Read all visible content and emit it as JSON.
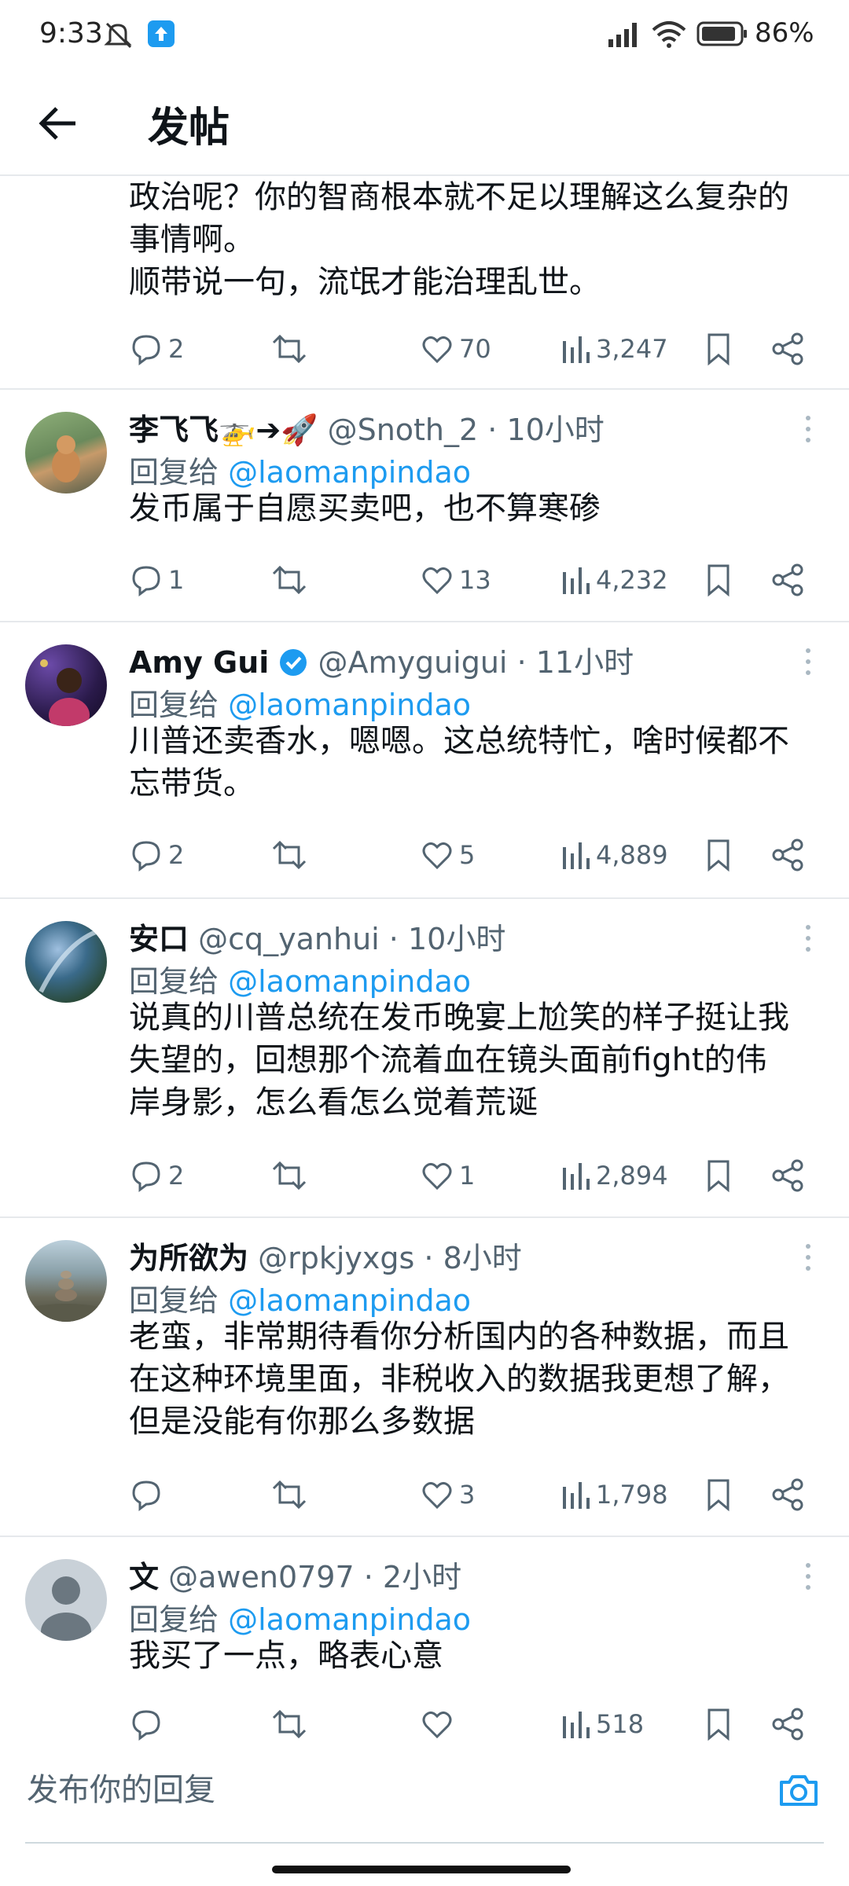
{
  "status_bar": {
    "time": "9:33",
    "battery": "86%"
  },
  "header": {
    "title": "发帖"
  },
  "partial_tweet": {
    "text_lines": [
      "政治呢？你的智商根本就不足以理解这么复杂的",
      "事情啊。",
      "顺带说一句，流氓才能治理乱世。"
    ],
    "stats": {
      "replies": "2",
      "retweets": "",
      "likes": "70",
      "views": "3,247"
    }
  },
  "reply_prefix": "回复给",
  "tweets": [
    {
      "name": "李飞飞🚁➔🚀",
      "handle": "@Snoth_2",
      "time": "10小时",
      "reply_to": "@laomanpindao",
      "text_lines": [
        "发币属于自愿买卖吧，也不算寒碜"
      ],
      "stats": {
        "replies": "1",
        "retweets": "",
        "likes": "13",
        "views": "4,232"
      }
    },
    {
      "name": "Amy Gui",
      "verified": true,
      "handle": "@Amyguigui",
      "time": "11小时",
      "reply_to": "@laomanpindao",
      "text_lines": [
        "川普还卖香水，嗯嗯。这总统特忙，啥时候都不",
        "忘带货。"
      ],
      "stats": {
        "replies": "2",
        "retweets": "",
        "likes": "5",
        "views": "4,889"
      }
    },
    {
      "name": "安口",
      "handle": "@cq_yanhui",
      "time": "10小时",
      "reply_to": "@laomanpindao",
      "text_lines": [
        "说真的川普总统在发币晚宴上尬笑的样子挺让我",
        "失望的，回想那个流着血在镜头面前fight的伟",
        "岸身影，怎么看怎么觉着荒诞"
      ],
      "stats": {
        "replies": "2",
        "retweets": "",
        "likes": "1",
        "views": "2,894"
      }
    },
    {
      "name": "为所欲为",
      "handle": "@rpkjyxgs",
      "time": "8小时",
      "reply_to": "@laomanpindao",
      "text_lines": [
        "老蛮，非常期待看你分析国内的各种数据，而且",
        "在这种环境里面，非税收入的数据我更想了解，",
        "但是没能有你那么多数据"
      ],
      "stats": {
        "replies": "",
        "retweets": "",
        "likes": "3",
        "views": "1,798"
      }
    },
    {
      "name": "文",
      "handle": "@awen0797",
      "time": "2小时",
      "reply_to": "@laomanpindao",
      "text_lines": [
        "我买了一点，略表心意"
      ],
      "stats": {
        "replies": "",
        "retweets": "",
        "likes": "",
        "views": "518"
      }
    }
  ],
  "compose": {
    "placeholder": "发布你的回复"
  },
  "colors": {
    "accent": "#1d9bf0",
    "text": "#0f1419",
    "secondary": "#536471",
    "divider": "#e6e9ec"
  },
  "icons": [
    "back-arrow-icon",
    "reply-icon",
    "retweet-icon",
    "like-icon",
    "views-icon",
    "bookmark-icon",
    "share-icon",
    "more-icon",
    "verified-badge-icon",
    "camera-icon"
  ]
}
